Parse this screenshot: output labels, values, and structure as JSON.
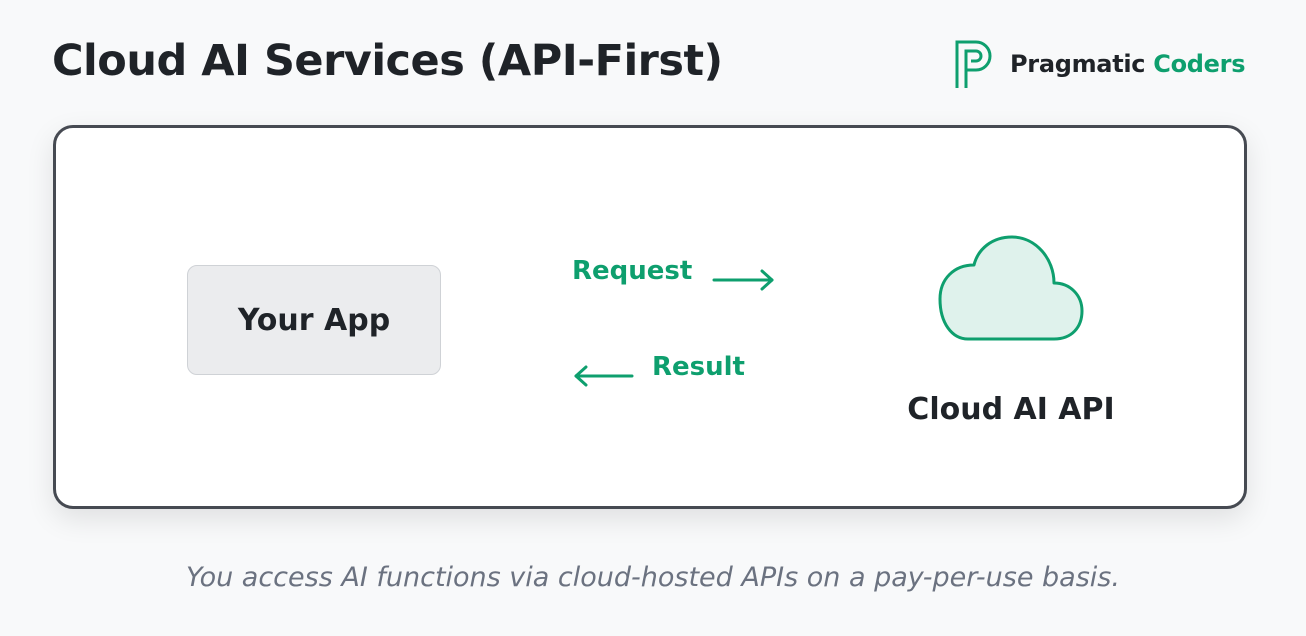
{
  "title": "Cloud AI Services (API-First)",
  "brand": {
    "name_part1": "Pragmatic",
    "name_part2": "Coders",
    "accent_color": "#0e9f6e",
    "logo_icon": "pc-logo-icon"
  },
  "diagram": {
    "app_label": "Your App",
    "request_label": "Request",
    "result_label": "Result",
    "cloud_label": "Cloud AI API",
    "cloud_icon": "cloud-icon",
    "arrow_color": "#0e9f6e",
    "cloud_fill": "#dff2ec"
  },
  "caption": "You access AI functions via cloud-hosted APIs on a pay-per-use basis."
}
